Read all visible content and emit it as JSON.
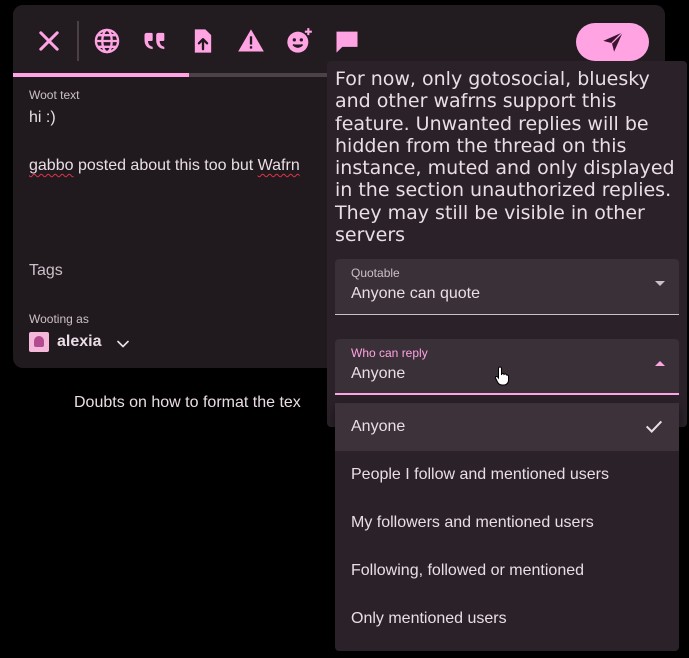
{
  "colors": {
    "accent": "#ffa3e3",
    "card_bg": "#201a1f",
    "panel_bg": "#2a2228",
    "field_bg": "#3a3038",
    "text": "#eadde5",
    "muted": "#cdbfc8",
    "spellcheck": "#e0334c"
  },
  "toolbar": {
    "icons": [
      "close-icon",
      "globe-icon",
      "quote-icon",
      "file-upload-icon",
      "warning-icon",
      "add-emoji-icon",
      "comment-icon",
      "send-icon"
    ],
    "active_tab_index": 0
  },
  "editor": {
    "woot_label": "Woot text",
    "line1": "hi :)",
    "line2_word": "gabbo",
    "line2_middle": " posted about this too but ",
    "line2_end": "Wafrn"
  },
  "tags": {
    "label": "Tags"
  },
  "account": {
    "label": "Wooting as",
    "name": "alexia"
  },
  "doubts": "Doubts on how to format the tex",
  "panel": {
    "notice": "For now, only gotosocial, bluesky and other wafrns support this feature. Unwanted replies will be hidden from the thread on this instance, muted and only displayed in the section unauthorized replies. They may still be visible in other servers",
    "quotable": {
      "label": "Quotable",
      "value": "Anyone can quote"
    },
    "who_can_reply": {
      "label": "Who can reply",
      "value": "Anyone"
    }
  },
  "menu": {
    "options": [
      {
        "label": "Anyone",
        "selected": true
      },
      {
        "label": "People I follow and mentioned users",
        "selected": false
      },
      {
        "label": "My followers and mentioned users",
        "selected": false
      },
      {
        "label": "Following, followed or mentioned",
        "selected": false
      },
      {
        "label": "Only mentioned users",
        "selected": false
      }
    ]
  }
}
